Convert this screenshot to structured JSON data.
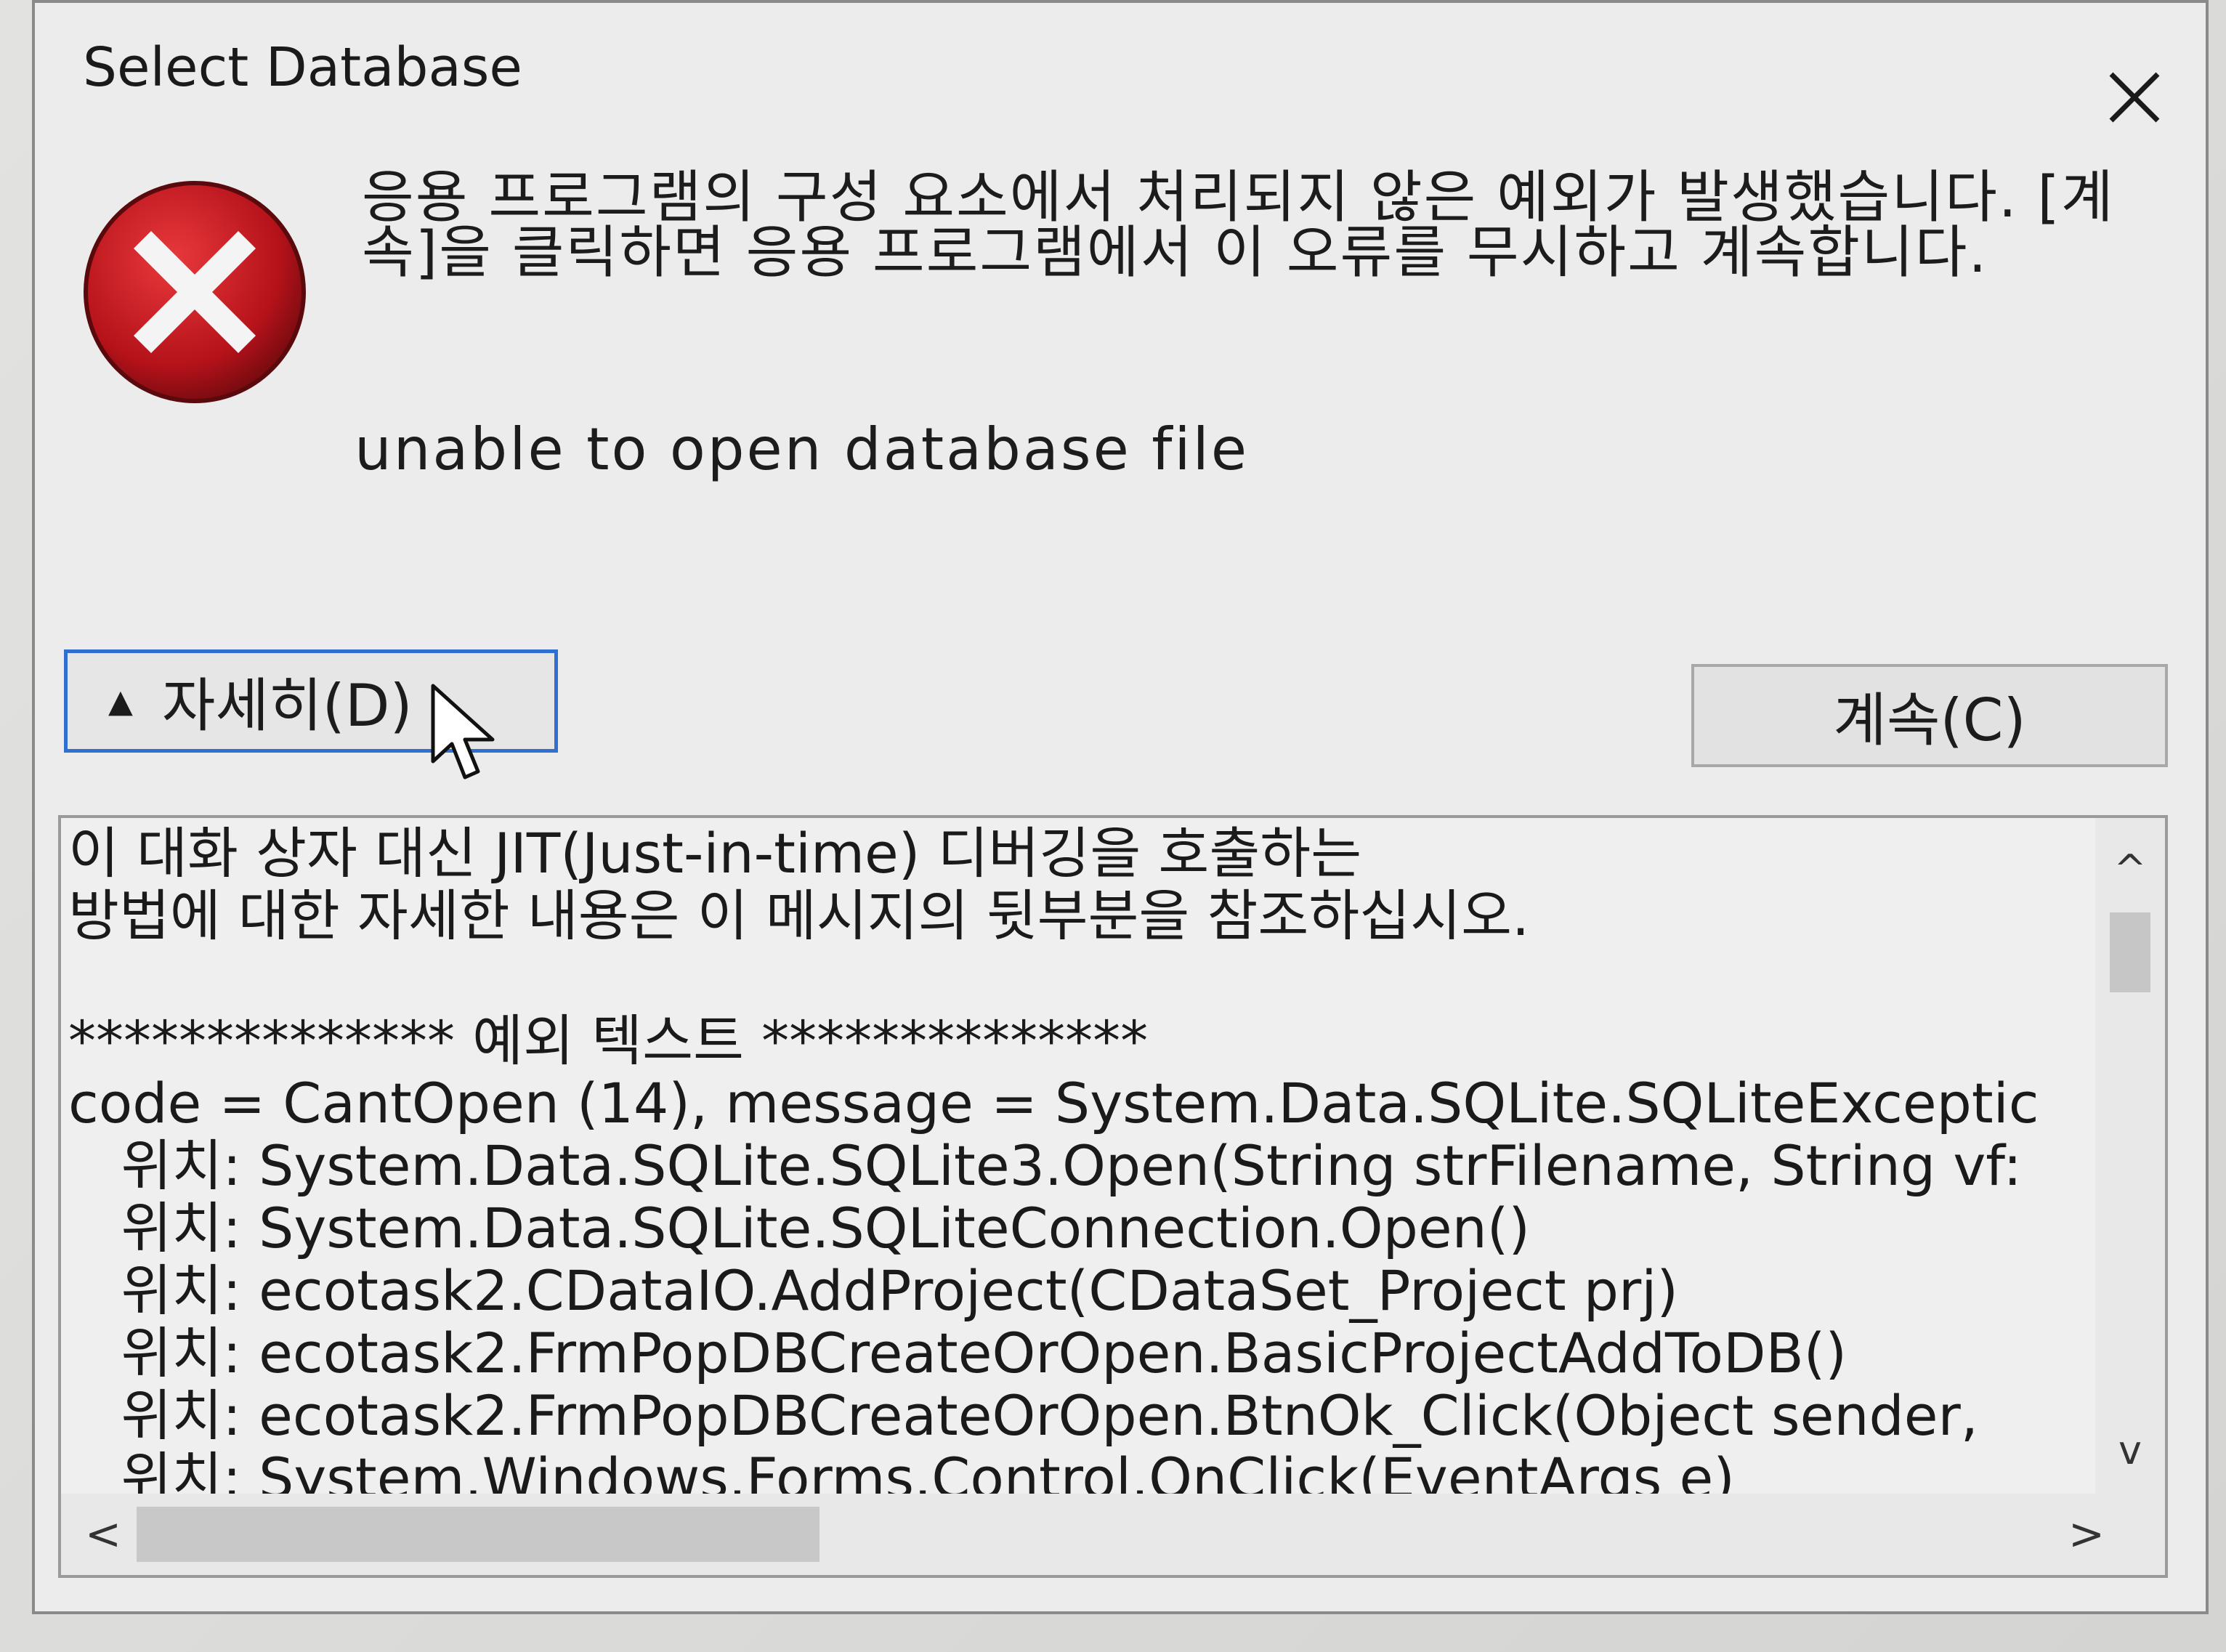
{
  "window": {
    "title": "Select Database"
  },
  "icons": {
    "close": "close-icon",
    "error": "error-icon",
    "expand": "triangle-up-icon"
  },
  "colors": {
    "error_red": "#c0171c",
    "focus_border": "#2f6fd0"
  },
  "message": {
    "main": "응용 프로그램의 구성 요소에서 처리되지 않은 예외가 발생했습니다. [계속]을 클릭하면 응용 프로그램에서 이 오류를 무시하고 계속합니다.",
    "detail": "unable to open database file"
  },
  "buttons": {
    "details_label": "자세히(D)",
    "details_arrow": "▲",
    "continue_label": "계속(C)"
  },
  "details": {
    "text": "이 대화 상자 대신 JIT(Just-in-time) 디버깅을 호출하는\n방법에 대한 자세한 내용은 이 메시지의 뒷부분을 참조하십시오.\n\n************** 예외 텍스트 **************\ncode = CantOpen (14), message = System.Data.SQLite.SQLiteExceptic\n   위치: System.Data.SQLite.SQLite3.Open(String strFilename, String vf:\n   위치: System.Data.SQLite.SQLiteConnection.Open()\n   위치: ecotask2.CDataIO.AddProject(CDataSet_Project prj)\n   위치: ecotask2.FrmPopDBCreateOrOpen.BasicProjectAddToDB()\n   위치: ecotask2.FrmPopDBCreateOrOpen.BtnOk_Click(Object sender,\n   위치: System.Windows.Forms.Control.OnClick(EventArgs e)"
  },
  "scrollbars": {
    "up": "^",
    "down": "v",
    "left": "<",
    "right": ">"
  }
}
